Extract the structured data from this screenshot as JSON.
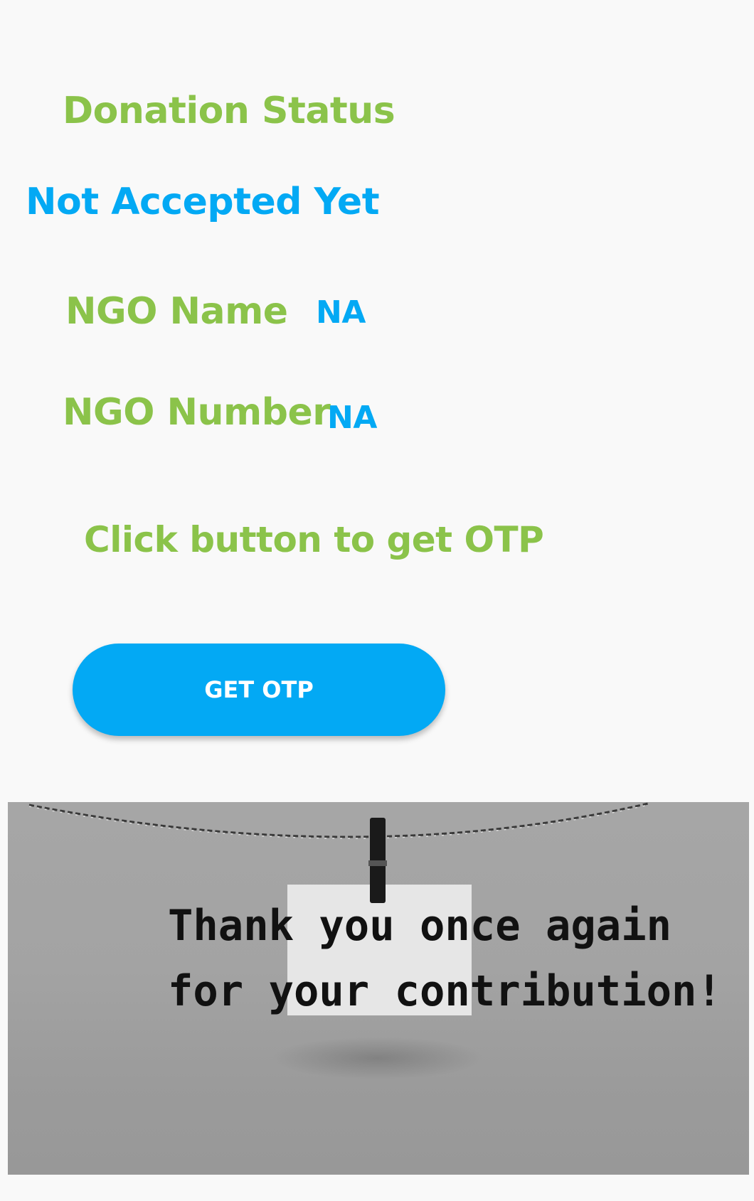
{
  "heading": "Donation Status",
  "status_value": "Not Accepted Yet",
  "ngo_name": {
    "label": "NGO Name",
    "value": "NA"
  },
  "ngo_number": {
    "label": "NGO Number",
    "value": "NA"
  },
  "otp_hint": "Click button to get OTP",
  "otp_button_label": "GET OTP",
  "banner": {
    "line1": "Thank you once again",
    "line2": "for your contribution!"
  },
  "colors": {
    "accent_green": "#8bc34a",
    "accent_blue": "#03a9f4",
    "background": "#f9f9f9"
  }
}
